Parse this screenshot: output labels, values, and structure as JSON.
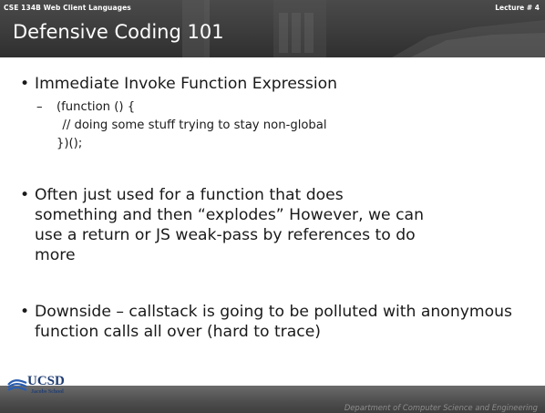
{
  "header": {
    "course": "CSE 134B  Web Client Languages",
    "lecture": "Lecture # 4",
    "title": "Defensive Coding 101"
  },
  "bullets": [
    {
      "text": "Immediate Invoke Function Expression"
    },
    {
      "text": "Often just used for a function that does something and then “explodes”  However, we can use a return or JS weak-pass by references to do more"
    },
    {
      "text": "Downside – callstack is going to be polluted with anonymous function calls all over (hard to trace)"
    }
  ],
  "sub": {
    "dash": "–",
    "code_line_1": "(function () {",
    "code_line_2": "  // doing some stuff trying to stay non-global",
    "code_line_3": "})();"
  },
  "footer": {
    "logo_text": "UCSD",
    "logo_sub": "Jacobs School",
    "dept": "Department of Computer Science and Engineering"
  }
}
